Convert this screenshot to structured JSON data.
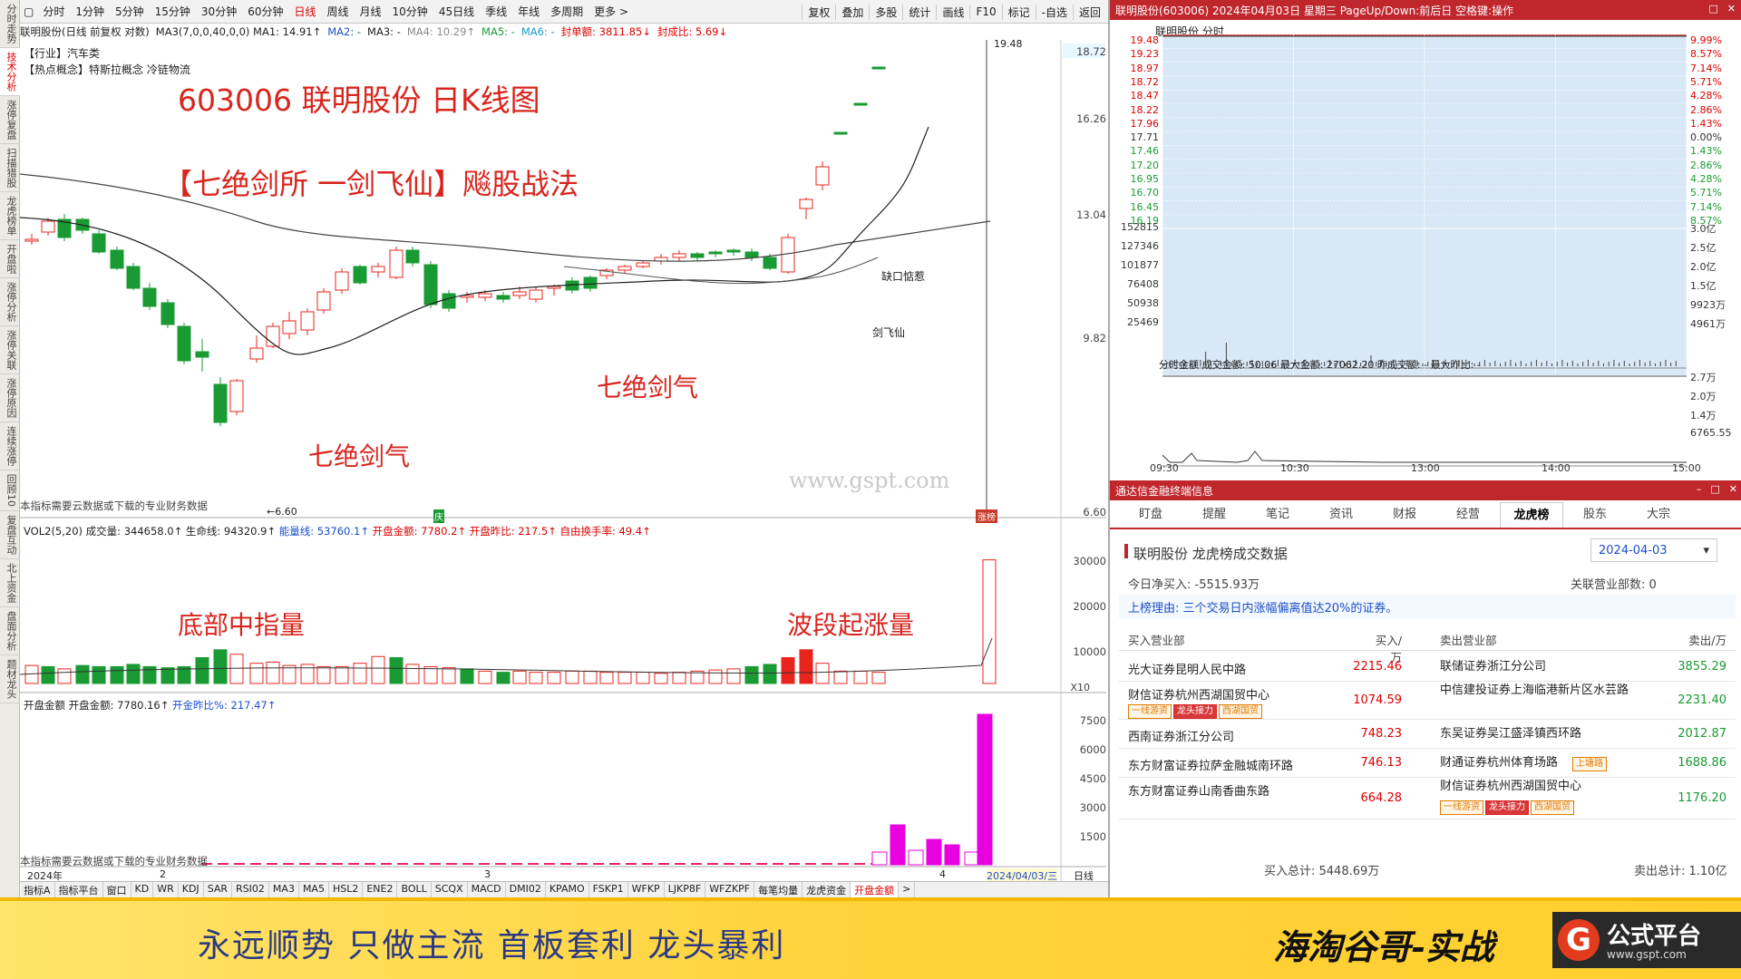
{
  "sidebar": [
    "分时走势",
    "技术分析",
    "涨停复盘",
    "扫描猎股",
    "龙虎榜单",
    "开盘啦",
    "涨停分析",
    "涨停关联",
    "涨停原因",
    "连续涨停",
    "回顾10",
    "复盘互动",
    "北上资金",
    "盘面分析",
    "题材龙头"
  ],
  "period_bar": [
    "分时",
    "1分钟",
    "5分钟",
    "15分钟",
    "30分钟",
    "60分钟",
    "日线",
    "周线",
    "月线",
    "10分钟",
    "45日线",
    "季线",
    "年线",
    "多周期",
    "更多 >"
  ],
  "active_period": "日线",
  "tool_bar": [
    "复权",
    "叠加",
    "多股",
    "统计",
    "画线",
    "F10",
    "标记",
    "-自选",
    "返回"
  ],
  "info": {
    "name": "联明股份(日线 前复权 对数)",
    "ma": "MA3(7,0,0,40,0,0)  MA1: 14.91↑",
    "ma2": "MA2: -",
    "ma3": "MA3: -",
    "ma4": "MA4: 10.29↑",
    "ma5": "MA5: -",
    "ma6": "MA6: -",
    "seal_amt": "封单额: 3811.85↓",
    "seal_ratio": "封成比: 5.69↓"
  },
  "industry": "【行业】汽车类",
  "concept": "【热点概念】特斯拉概念 冷链物流",
  "kline": {
    "title": "603006 联明股份 日K线图",
    "subtitle": "【七绝剑所  一剑飞仙】飚股战法",
    "label_a": "七绝剑气",
    "label_b": "七绝剑气",
    "note_gap": "缺口惦惹",
    "note_fly": "剑飞仙",
    "high": "19.48",
    "low": "←6.60",
    "watermark": "www.gspt.com",
    "notice": "本指标需要云数据或下载的专业财务数据",
    "marker": "涨榜",
    "marker2": "庆",
    "price_axis": [
      "18.72",
      "16.26",
      "13.04",
      "9.82",
      "6.60"
    ]
  },
  "volume": {
    "header_vol": "VOL2(5,20) 成交量: 344658.0↑ 生命线: 94320.9↑",
    "header_energy": "能量线: 53760.1↑",
    "header_open": "开盘金额: 7780.2↑ 开盘昨比: 217.5↑",
    "header_turn": "自由换手率: 49.4↑",
    "label_bottom": "底部中指量",
    "label_rise": "波段起涨量",
    "axis": [
      "30000",
      "20000",
      "10000",
      "X10"
    ]
  },
  "open_amt": {
    "header_amt": "开盘金额  开盘金额: 7780.16↑",
    "header_ratio": "开金昨比%: 217.47↑",
    "notice": "本指标需要云数据或下载的专业财务数据",
    "axis": [
      "7500",
      "6000",
      "4500",
      "3000",
      "1500"
    ]
  },
  "date_axis": [
    "2024年",
    "2",
    "3",
    "4",
    "2024/04/03/三",
    "日线"
  ],
  "bottom_tabs": [
    "指标A",
    "指标平台",
    "窗口",
    "KD",
    "WR",
    "KDJ",
    "SAR",
    "RSI02",
    "MA3",
    "MA5",
    "HSL2",
    "ENE2",
    "BOLL",
    "SCQX",
    "MACD",
    "DMI02",
    "KPAMO",
    "FSKP1",
    "WFKP",
    "LJKP8F",
    "WFZKPF",
    "每笔均量",
    "龙虎资金",
    "开盘金额",
    ">"
  ],
  "active_bottom_tab": "开盘金额",
  "intraday": {
    "title": "联明股份(603006) 2024年04月03日 星期三 PageUp/Down:前后日 空格键:操作",
    "head": "联明股份  分时",
    "left_axis": [
      "19.48",
      "19.23",
      "18.97",
      "18.72",
      "18.47",
      "18.22",
      "17.96",
      "17.71",
      "17.46",
      "17.20",
      "16.95",
      "16.70",
      "16.45",
      "16.19",
      "152815",
      "127346",
      "101877",
      "76408",
      "50938",
      "25469"
    ],
    "right_axis": [
      "9.99%",
      "8.57%",
      "7.14%",
      "5.71%",
      "4.28%",
      "2.86%",
      "1.43%",
      "0.00%",
      "1.43%",
      "2.86%",
      "4.28%",
      "5.71%",
      "7.14%",
      "8.57%",
      "3.0亿",
      "2.5亿",
      "2.0亿",
      "1.5亿",
      "9923万",
      "4961万"
    ],
    "sub_header": "分时金额  成交金额: 50.06  最大金额: 27062.20  昨成交额: - 最大昨比: -",
    "sub_right": [
      "2.7万",
      "2.0万",
      "1.4万",
      "6765.55"
    ],
    "times": [
      "09:30",
      "10:30",
      "13:00",
      "14:00",
      "15:00"
    ]
  },
  "lhb": {
    "window_title": "通达信金融终端信息",
    "tabs": [
      "盯盘",
      "提醒",
      "笔记",
      "资讯",
      "财报",
      "经营",
      "龙虎榜",
      "股东",
      "大宗"
    ],
    "active_tab": "龙虎榜",
    "heading": "联明股份 龙虎榜成交数据",
    "date": "2024-04-03",
    "net": "今日净买入: -5515.93万",
    "branches": "关联营业部数: 0",
    "reason": "上榜理由: 三个交易日内涨幅偏离值达20%的证券。",
    "col_buy": "买入营业部",
    "col_buy_amt": "买入/万",
    "col_sell": "卖出营业部",
    "col_sell_amt": "卖出/万",
    "rows": [
      {
        "buy": "光大证券昆明人民中路",
        "buy_amt": "2215.46",
        "buy_tags": [],
        "sell": "联储证券浙江分公司",
        "sell_amt": "3855.29",
        "sell_tags": []
      },
      {
        "buy": "财信证券杭州西湖国贸中心",
        "buy_amt": "1074.59",
        "buy_tags": [
          "一线游资",
          "龙头接力",
          "西湖国贸"
        ],
        "sell": "中信建投证券上海临港新片区水芸路",
        "sell_amt": "2231.40",
        "sell_tags": []
      },
      {
        "buy": "西南证券浙江分公司",
        "buy_amt": "748.23",
        "buy_tags": [],
        "sell": "东吴证券吴江盛泽镇西环路",
        "sell_amt": "2012.87",
        "sell_tags": []
      },
      {
        "buy": "东方财富证券拉萨金融城南环路",
        "buy_amt": "746.13",
        "buy_tags": [],
        "sell": "财通证券杭州体育场路",
        "sell_amt": "1688.86",
        "sell_tags": [
          "上塘路"
        ]
      },
      {
        "buy": "东方财富证券山南香曲东路",
        "buy_amt": "664.28",
        "buy_tags": [],
        "sell": "财信证券杭州西湖国贸中心",
        "sell_amt": "1176.20",
        "sell_tags": [
          "一线游资",
          "龙头接力",
          "西湖国贸"
        ]
      }
    ],
    "buy_total": "买入总计: 5448.69万",
    "sell_total": "卖出总计: 1.10亿"
  },
  "banner": {
    "slogan": "永远顺势  只做主流  首板套利  龙头暴利",
    "author": "海淘谷哥-实战",
    "logo_text": "公式平台",
    "logo_url": "www.gspt.com"
  },
  "colors": {
    "up": "#e8241c",
    "down": "#1a9a33",
    "accent": "#c0272d",
    "blue": "#1a4fc8",
    "magenta": "#e800e0"
  }
}
